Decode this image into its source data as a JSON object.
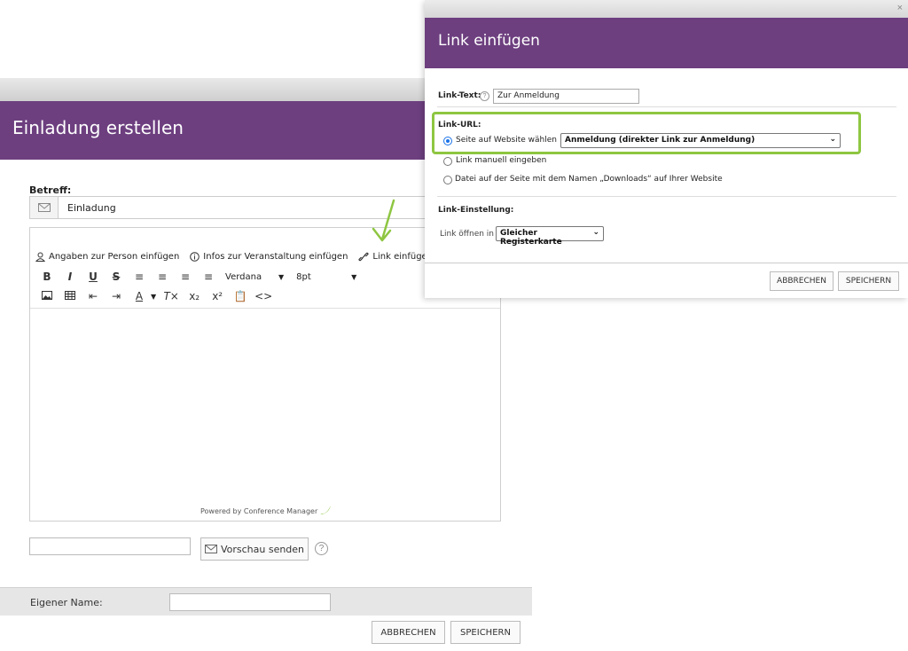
{
  "invitation_dialog": {
    "title": "Einladung erstellen",
    "subject_label": "Betreff:",
    "subject_value": "Einladung",
    "toolbar": {
      "insert_person": "Angaben zur Person einfügen",
      "event_info": "Infos zur Veranstaltung einfügen",
      "insert_link": "Link einfügen",
      "font_family": "Verdana",
      "font_size": "8pt"
    },
    "powered_by": "Powered by Conference Manager",
    "preview_button": "Vorschau senden",
    "help_symbol": "?",
    "own_name_label": "Eigener Name:",
    "cancel_button": "ABBRECHEN",
    "save_button": "SPEICHERN"
  },
  "link_dialog": {
    "close_symbol": "×",
    "title": "Link einfügen",
    "link_text_label": "Link-Text:",
    "link_text_value": "Zur Anmeldung",
    "link_url_label": "Link-URL:",
    "options": [
      "Seite auf Website wählen",
      "Link manuell eingeben",
      "Datei auf der Seite mit dem Namen „Downloads“ auf Ihrer Website"
    ],
    "selected_option": "Seite auf Website wählen",
    "page_select_value": "Anmeldung (direkter Link zur Anmeldung)",
    "link_setting_label": "Link-Einstellung:",
    "open_in_label": "Link öffnen in",
    "open_in_value": "Gleicher Registerkarte",
    "cancel_button": "ABBRECHEN",
    "save_button": "SPEICHERN"
  },
  "colors": {
    "header_purple": "#6d3f7f",
    "highlight_green": "#8ec641"
  }
}
